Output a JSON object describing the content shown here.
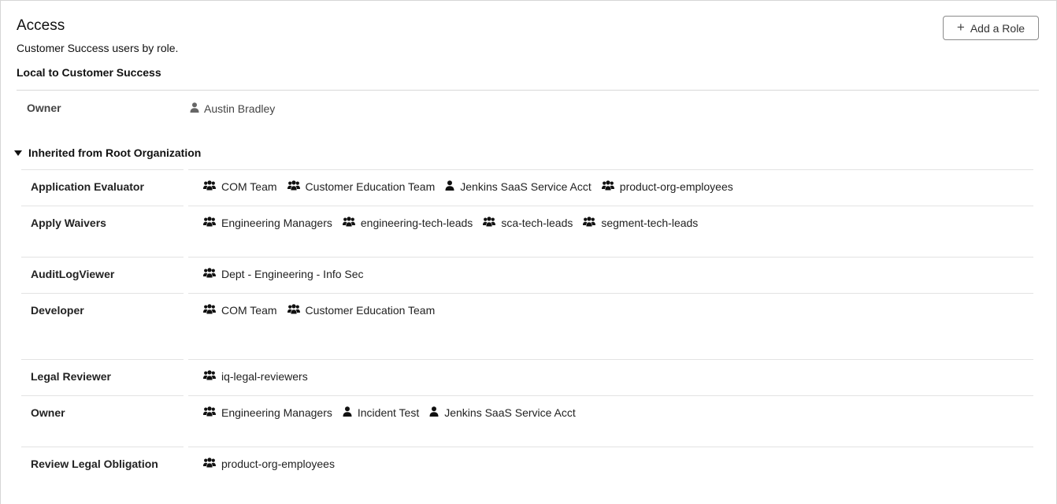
{
  "header": {
    "title": "Access",
    "subtitle": "Customer Success users by role.",
    "add_role_label": "Add a Role"
  },
  "local": {
    "section_label": "Local to Customer Success",
    "roles": [
      {
        "role": "Owner",
        "members": [
          {
            "type": "user",
            "name": "Austin Bradley"
          }
        ]
      }
    ]
  },
  "inherited": {
    "section_label": "Inherited from Root Organization",
    "expanded": true,
    "roles": [
      {
        "role": "Application Evaluator",
        "members": [
          {
            "type": "group",
            "name": "COM Team"
          },
          {
            "type": "group",
            "name": "Customer Education Team"
          },
          {
            "type": "user",
            "name": "Jenkins SaaS Service Acct"
          },
          {
            "type": "group",
            "name": "product-org-employees"
          }
        ]
      },
      {
        "role": "Apply Waivers",
        "members": [
          {
            "type": "group",
            "name": "Engineering Managers"
          },
          {
            "type": "group",
            "name": "engineering-tech-leads"
          },
          {
            "type": "group",
            "name": "sca-tech-leads"
          },
          {
            "type": "group",
            "name": "segment-tech-leads"
          }
        ]
      },
      {
        "role": "AuditLogViewer",
        "members": [
          {
            "type": "group",
            "name": "Dept - Engineering - Info Sec"
          }
        ]
      },
      {
        "role": "Developer",
        "members": [
          {
            "type": "group",
            "name": "COM Team"
          },
          {
            "type": "group",
            "name": "Customer Education Team"
          }
        ]
      },
      {
        "role": "Legal Reviewer",
        "members": [
          {
            "type": "group",
            "name": "iq-legal-reviewers"
          }
        ]
      },
      {
        "role": "Owner",
        "members": [
          {
            "type": "group",
            "name": "Engineering Managers"
          },
          {
            "type": "user",
            "name": "Incident Test"
          },
          {
            "type": "user",
            "name": "Jenkins SaaS Service Acct"
          }
        ]
      },
      {
        "role": "Review Legal Obligation",
        "members": [
          {
            "type": "group",
            "name": "product-org-employees"
          }
        ]
      }
    ]
  },
  "icons": {
    "user": "user-icon",
    "group": "users-group-icon",
    "add": "plus-icon",
    "expand": "caret-down-icon"
  }
}
